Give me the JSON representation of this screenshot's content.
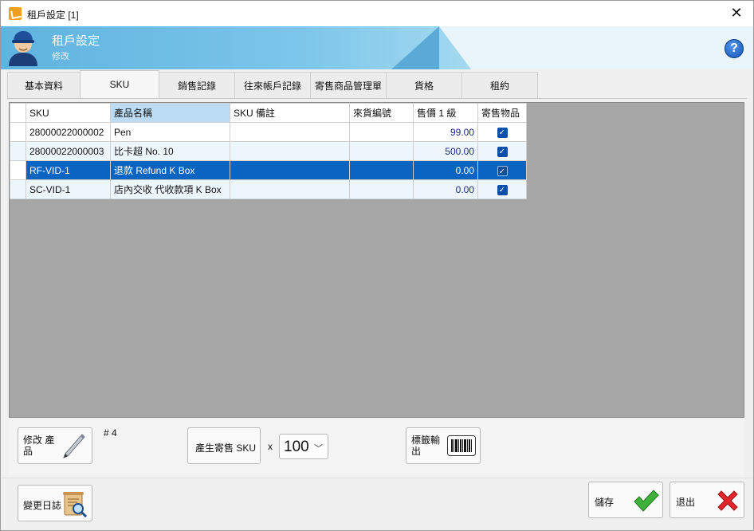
{
  "window": {
    "title": "租戶設定 [1]"
  },
  "banner": {
    "title": "租戶設定",
    "subtitle": "修改"
  },
  "tabs": [
    {
      "label": "基本資料"
    },
    {
      "label": "SKU"
    },
    {
      "label": "銷售記錄"
    },
    {
      "label": "往來帳戶記錄"
    },
    {
      "label": "寄售商品管理單"
    },
    {
      "label": "貨格"
    },
    {
      "label": "租約"
    }
  ],
  "grid": {
    "columns": [
      "SKU",
      "產品名稱",
      "SKU 備註",
      "來貨編號",
      "售價 1 級",
      "寄售物品"
    ],
    "rows": [
      {
        "sku": "28000022000002",
        "name": "Pen",
        "note": "",
        "ref": "",
        "price": "99.00",
        "consign": true
      },
      {
        "sku": "28000022000003",
        "name": "比卡超 No. 10",
        "note": "",
        "ref": "",
        "price": "500.00",
        "consign": true
      },
      {
        "sku": "RF-VID-1",
        "name": "退款 Refund K Box",
        "note": "",
        "ref": "",
        "price": "0.00",
        "consign": true
      },
      {
        "sku": "SC-VID-1",
        "name": "店內交收 代收款項 K Box",
        "note": "",
        "ref": "",
        "price": "0.00",
        "consign": true
      }
    ]
  },
  "lower": {
    "edit_label_1": "修改 產",
    "edit_label_2": "品",
    "count_label": "# 4",
    "gen_label": "產生寄售 SKU",
    "multiplier": "x",
    "qty_value": "100",
    "label_out_1": "標籤輸",
    "label_out_2": "出"
  },
  "bottom": {
    "log_label": "變更日誌",
    "save_label": "儲存",
    "exit_label": "退出"
  },
  "colors": {
    "selected_row": "#0a64c2",
    "header_sorted": "#bcdcf5",
    "banner": "#5fb3df"
  }
}
